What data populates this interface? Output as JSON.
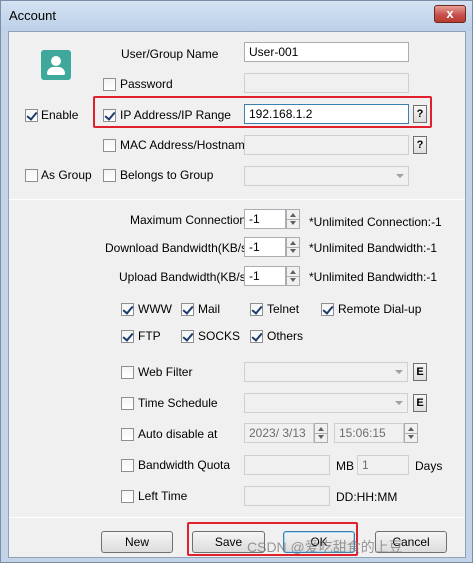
{
  "window": {
    "title": "Account",
    "close_glyph": "x"
  },
  "identity": {
    "user_group_name_label": "User/Group Name",
    "user_group_name_value": "User-001",
    "password_label": "Password",
    "password_checked": false,
    "ip_label": "IP Address/IP Range",
    "ip_checked": true,
    "ip_value": "192.168.1.2",
    "ip_help": "?",
    "mac_label": "MAC Address/Hostname",
    "mac_checked": false,
    "mac_help": "?",
    "enable_label": "Enable",
    "enable_checked": true,
    "as_group_label": "As Group",
    "as_group_checked": false,
    "belongs_label": "Belongs to Group",
    "belongs_checked": false
  },
  "limits": {
    "max_conn_label": "Maximum Connections",
    "max_conn_value": "-1",
    "max_conn_hint": "*Unlimited Connection:-1",
    "download_label": "Download Bandwidth(KB/s)",
    "download_value": "-1",
    "download_hint": "*Unlimited Bandwidth:-1",
    "upload_label": "Upload Bandwidth(KB/s)",
    "upload_value": "-1",
    "upload_hint": "*Unlimited Bandwidth:-1"
  },
  "services": {
    "www": "WWW",
    "mail": "Mail",
    "telnet": "Telnet",
    "remote_dialup": "Remote Dial-up",
    "ftp": "FTP",
    "socks": "SOCKS",
    "others": "Others"
  },
  "policies": {
    "web_filter_label": "Web Filter",
    "web_filter_edit": "E",
    "time_schedule_label": "Time Schedule",
    "time_schedule_edit": "E",
    "auto_disable_label": "Auto disable at",
    "auto_disable_date": "2023/  3/13",
    "auto_disable_time": "15:06:15",
    "bandwidth_quota_label": "Bandwidth Quota",
    "bandwidth_quota_unit": "MB",
    "bandwidth_quota_days_value": "1",
    "bandwidth_quota_days_label": "Days",
    "left_time_label": "Left Time",
    "left_time_format": "DD:HH:MM"
  },
  "buttons": {
    "new": "New",
    "save": "Save",
    "ok": "OK",
    "cancel": "Cancel"
  },
  "watermark": "CSDN @爱吃甜食的上豆",
  "colors": {
    "highlight": "#e0202a",
    "avatar": "#3ea89a",
    "window_frame": "#c3d4e8"
  }
}
